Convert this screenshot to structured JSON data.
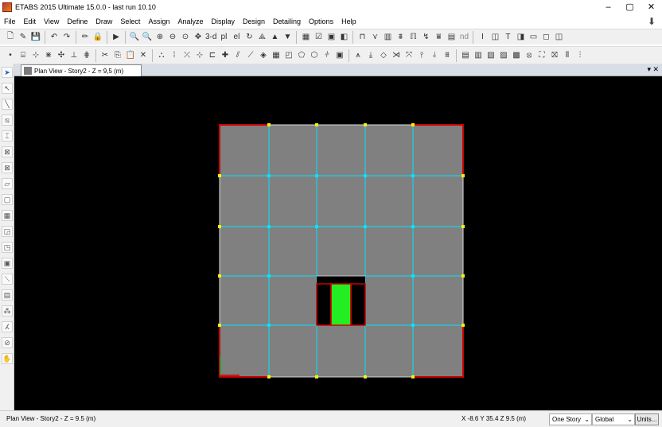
{
  "window": {
    "title": "ETABS 2015 Ultimate 15.0.0 - last run 10.10",
    "controls": [
      "–",
      "▢",
      "✕"
    ]
  },
  "menu": [
    "File",
    "Edit",
    "View",
    "Define",
    "Draw",
    "Select",
    "Assign",
    "Analyze",
    "Display",
    "Design",
    "Detailing",
    "Options",
    "Help"
  ],
  "toolbar1": {
    "view_3d_label": "3-d",
    "plan_label": "pl",
    "elev_label": "el",
    "nd_label": "nd"
  },
  "tab": {
    "label": "Plan View - Story2 - Z = 9,5 (m)",
    "controls": "▾ ✕"
  },
  "status": {
    "view_label": "Plan View - Story2 - Z = 9.5 (m)",
    "coords": "X -8.6  Y 35.4  Z 9.5 (m)",
    "story_select": "One Story",
    "coord_select": "Global",
    "units_button": "Units..."
  },
  "colors": {
    "canvas_bg": "#000000",
    "slab": "#808080",
    "grid": "#00e5ff",
    "beam": "#cc0000",
    "opening_fill": "#22ee22",
    "joint": "#ffee00"
  }
}
